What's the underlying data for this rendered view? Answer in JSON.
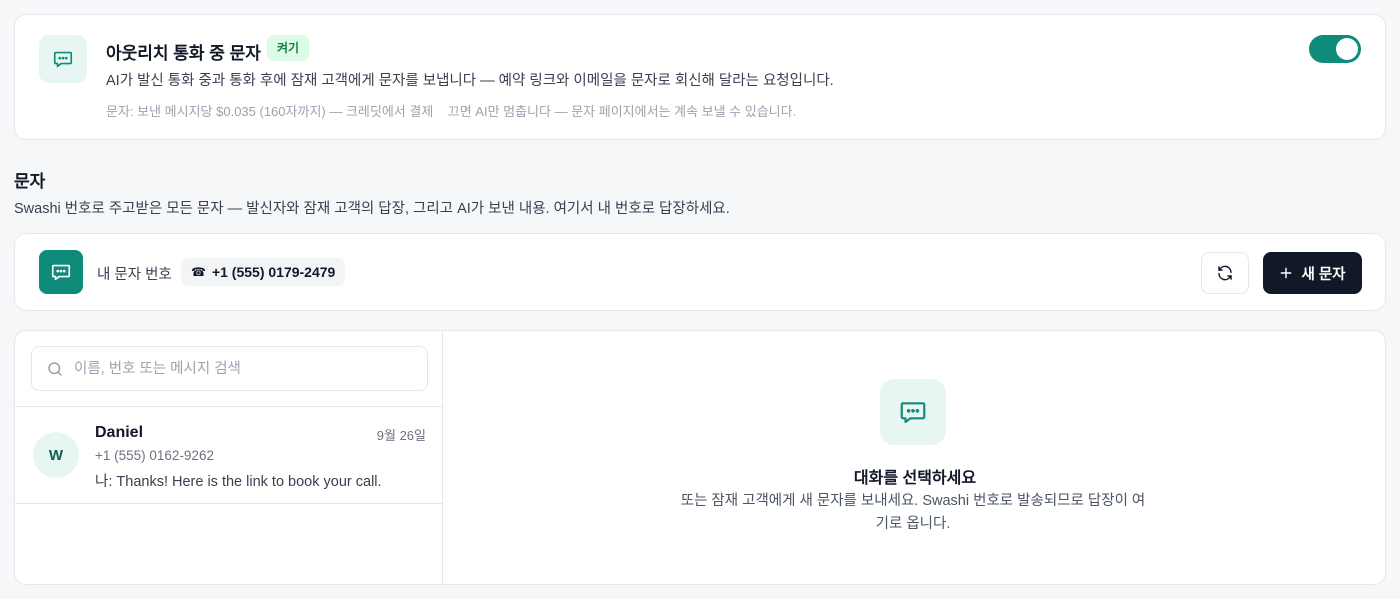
{
  "outreach": {
    "title": "아웃리치 통화 중 문자",
    "badge": "켜기",
    "description": "AI가 발신 통화 중과 통화 후에 잠재 고객에게 문자를 보냅니다 — 예약 링크와 이메일을 문자로 회신해 달라는 요청입니다.",
    "pricing_note": "문자: 보낸 메시지당 $0.035 (160자까지) — 크레딧에서 결제",
    "off_note": "끄면 AI만 멈춥니다 — 문자 페이지에서는 계속 보낼 수 있습니다.",
    "toggle_on": true,
    "icon": "message-bubble-icon"
  },
  "section": {
    "title": "문자",
    "description": "Swashi 번호로 주고받은 모든 문자 — 발신자와 잠재 고객의 답장, 그리고 AI가 보낸 내용. 여기서 내 번호로 답장하세요."
  },
  "number_bar": {
    "label": "내 문자 번호",
    "phone_glyph": "☎",
    "number": "+1 (555) 0179-2479",
    "new_button": "새 문자",
    "refresh_icon": "refresh-icon"
  },
  "inbox": {
    "search_placeholder": "이름, 번호 또는 메시지 검색",
    "conversations": [
      {
        "initial": "W",
        "name": "Daniel",
        "date": "9월 26일",
        "phone": "+1 (555) 0162-9262",
        "preview": "나: Thanks! Here is the link to book your call."
      }
    ],
    "empty_state": {
      "title": "대화를 선택하세요",
      "description": "또는 잠재 고객에게 새 문자를 보내세요. Swashi 번호로 발송되므로 답장이 여기로 옵니다."
    }
  },
  "colors": {
    "accent": "#0f8b7a",
    "accent_light": "#e7f6f2",
    "dark_button": "#111827",
    "badge_bg": "#dcfce7",
    "badge_text": "#15803d"
  }
}
